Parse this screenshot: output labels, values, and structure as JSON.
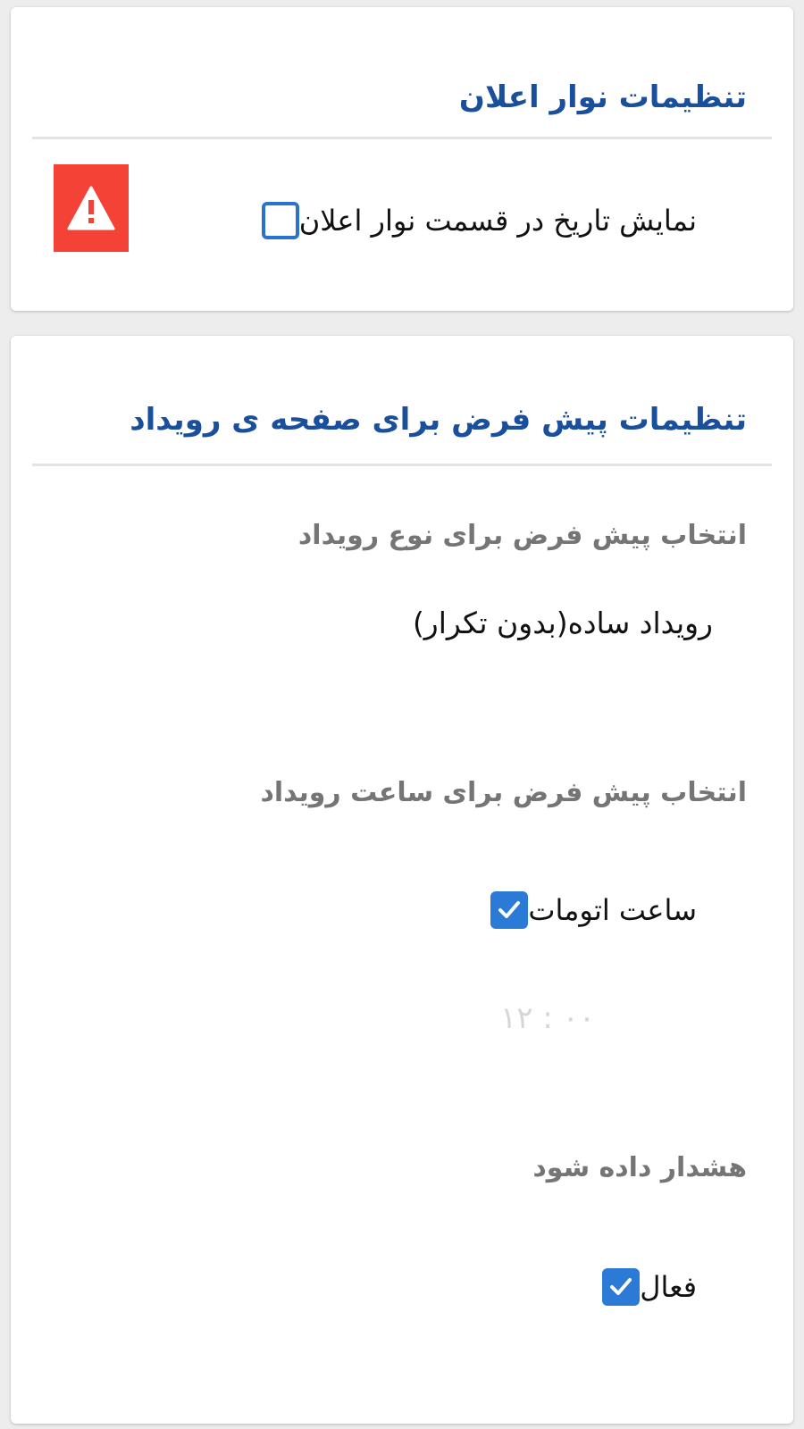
{
  "notification_bar": {
    "title": "تنظیمات نوار اعلان",
    "show_date": {
      "label": "نمایش تاریخ در قسمت نوار اعلان",
      "checked": false
    },
    "warning_icon": "warning-triangle-icon",
    "warning_color": "#f44236"
  },
  "event_defaults": {
    "title": "تنظیمات پیش فرض برای صفحه ی رویداد",
    "event_type": {
      "label": "انتخاب پیش فرض برای نوع رویداد",
      "value": "رویداد ساده(بدون تکرار)"
    },
    "event_time": {
      "label": "انتخاب پیش فرض برای ساعت رویداد",
      "auto_time": {
        "label": "ساعت اتومات",
        "checked": true
      },
      "time_value": "۱۲ : ۰۰"
    },
    "alert": {
      "label": "هشدار داده شود",
      "active": {
        "label": "فعال",
        "checked": true
      }
    }
  },
  "colors": {
    "title": "#1a4f9c",
    "checkbox": "#2b7ad6",
    "divider": "#e4e4dc"
  }
}
